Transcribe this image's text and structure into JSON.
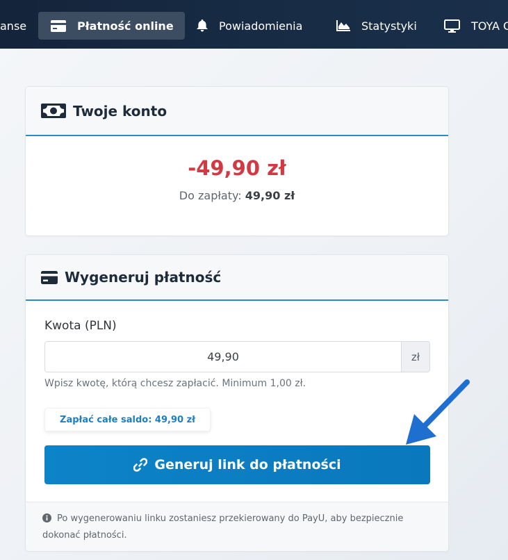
{
  "nav": {
    "items": [
      {
        "label": "anse",
        "icon": "none",
        "active": false
      },
      {
        "label": "Płatność online",
        "icon": "credit-card-icon",
        "active": true
      },
      {
        "label": "Powiadomienia",
        "icon": "bell-icon",
        "active": false
      },
      {
        "label": "Statystyki",
        "icon": "area-chart-icon",
        "active": false
      },
      {
        "label": "TOYA G",
        "icon": "monitor-icon",
        "active": false
      }
    ]
  },
  "account": {
    "title": "Twoje konto",
    "icon": "money-bill-icon",
    "balance": "-49,90 zł",
    "due_label": "Do zapłaty:",
    "due_value": "49,90 zł"
  },
  "payment": {
    "title": "Wygeneruj płatność",
    "icon": "credit-card-icon",
    "amount_label": "Kwota (PLN)",
    "amount_value": "49,90",
    "currency": "zł",
    "help_text": "Wpisz kwotę, którą chcesz zapłacić. Minimum 1,00 zł.",
    "pay_all_label": "Zapłać całe saldo: 49,90 zł",
    "generate_label": "Generuj link do płatności",
    "footer_note": "Po wygenerowaniu linku zostaniesz przekierowany do PayU, aby bezpiecznie dokonać płatności."
  },
  "colors": {
    "nav_bg": "#172b44",
    "accent": "#0d83c8",
    "balance_negative": "#d13a43",
    "arrow": "#1f6fd1"
  }
}
